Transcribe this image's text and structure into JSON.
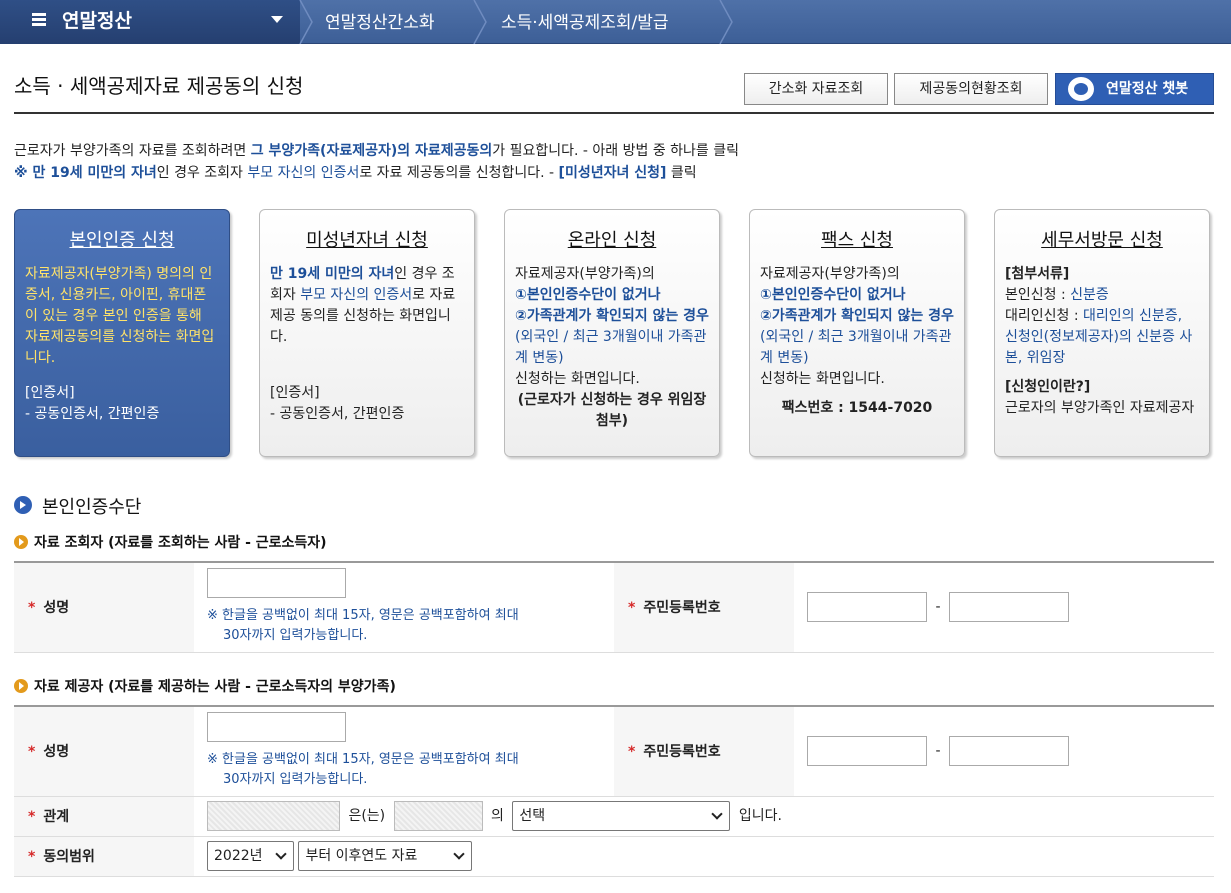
{
  "nav": {
    "menu_title": "연말정산",
    "crumbs": [
      "연말정산간소화",
      "소득·세액공제조회/발급"
    ]
  },
  "header": {
    "title": "소득 · 세액공제자료 제공동의 신청",
    "btn_simple": "간소화 자료조회",
    "btn_status": "제공동의현황조회",
    "btn_chatbot": "연말정산 챗봇"
  },
  "intro": {
    "l1_a": "근로자가 부양가족의 자료를 조회하려면 ",
    "l1_b": "그 부양가족(자료제공자)의 자료제공동의",
    "l1_c": "가 필요합니다. - 아래 방법 중 하나를 클릭",
    "l2_a": "※ 만 19세 미만의 자녀",
    "l2_b": "인 경우 조회자 ",
    "l2_c": "부모 자신의 인증서",
    "l2_d": "로 자료 제공동의를 신청합니다. - ",
    "l2_e": "[미성년자녀 신청]",
    "l2_f": " 클릭"
  },
  "cards": {
    "self": {
      "title": "본인인증 신청",
      "desc": "자료제공자(부양가족) 명의의 인증서, 신용카드, 아이핀, 휴대폰이 있는 경우 본인 인증을 통해 자료제공동의를 신청하는 화면입니다.",
      "cert_head": "[인증서]",
      "cert_body": "- 공동인증서, 간편인증"
    },
    "minor": {
      "title": "미성년자녀 신청",
      "d_a": "만 19세 미만의 자녀",
      "d_b": "인 경우 조회자 ",
      "d_c": "부모 자신의 인증서",
      "d_d": "로 자료 제공 동의를 신청하는 화면입니다.",
      "cert_head": "[인증서]",
      "cert_body": "- 공동인증서, 간편인증"
    },
    "online": {
      "title": "온라인 신청",
      "d1": "자료제공자(부양가족)의",
      "d2": "①본인인증수단이 없거나",
      "d3": "②가족관계가 확인되지 않는 경우",
      "d4": "(외국인 / 최근 3개월이내 가족관계 변동)",
      "d5": "신청하는 화면입니다.",
      "d6": "(근로자가 신청하는 경우 위임장 첨부)"
    },
    "fax": {
      "title": "팩스 신청",
      "d1": "자료제공자(부양가족)의",
      "d2": "①본인인증수단이 없거나",
      "d3": "②가족관계가 확인되지 않는 경우",
      "d4": "(외국인 / 최근 3개월이내 가족관계 변동)",
      "d5": "신청하는 화면입니다.",
      "fax_no": "팩스번호 : 1544-7020"
    },
    "visit": {
      "title": "세무서방문 신청",
      "docs_head": "[첨부서류]",
      "self_lbl": "본인신청 : ",
      "self_val": "신분증",
      "proxy_lbl": "대리인신청 : ",
      "proxy_val": "대리인의 신분증, 신청인(정보제공자)의 신분증 사본, 위임장",
      "who_head": "[신청인이란?]",
      "who_body": "근로자의 부양가족인 자료제공자"
    }
  },
  "section": {
    "title": "본인인증수단",
    "viewer_title": "자료 조회자 (자료를 조회하는 사람 - 근로소득자)",
    "provider_title": "자료 제공자 (자료를 제공하는 사람 - 근로소득자의 부양가족)"
  },
  "form": {
    "name_label": "성명",
    "rrn_label": "주민등록번호",
    "name_note_1": "※ 한글을 공백없이 최대 15자, 영문은 공백포함하여 최대",
    "name_note_2": "30자까지 입력가능합니다.",
    "dash": "-",
    "relation_label": "관계",
    "rel_eun": "은(는)",
    "rel_ui": "의",
    "rel_select": "선택",
    "rel_end": "입니다.",
    "range_label": "동의범위",
    "year_select": "2022년",
    "range_select": "부터 이후연도 자료",
    "req": "*"
  }
}
